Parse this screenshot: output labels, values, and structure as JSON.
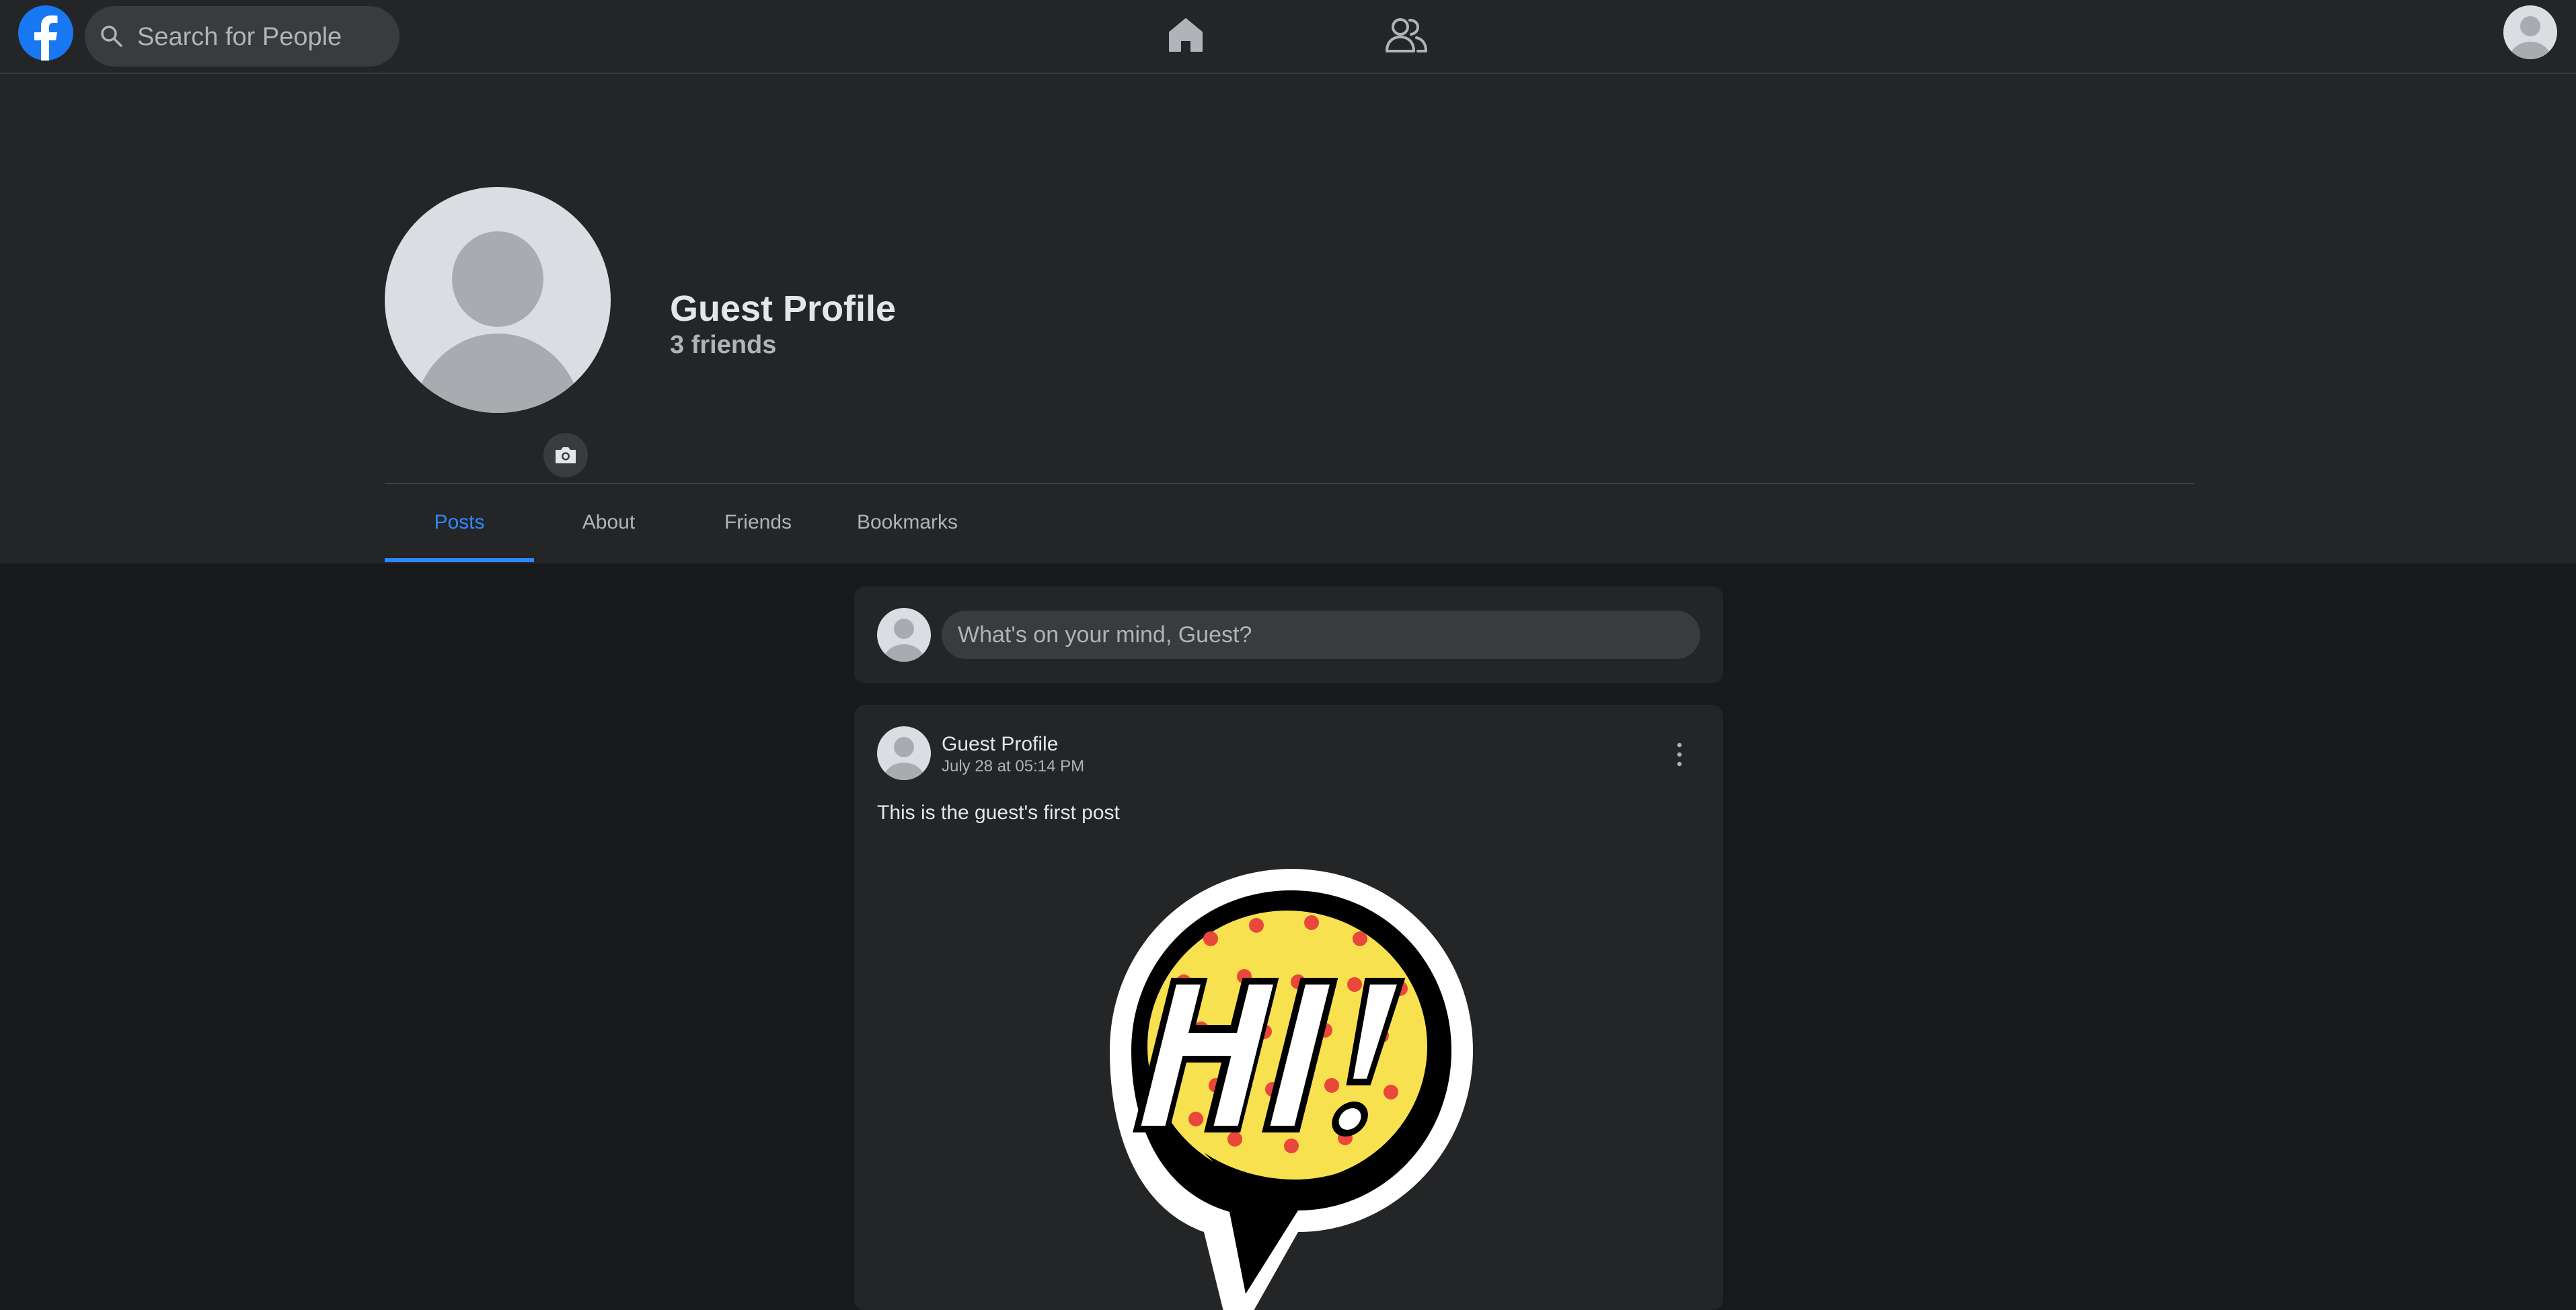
{
  "nav": {
    "search": {
      "placeholder": "Search for People"
    },
    "icons": [
      "facebook-logo",
      "search-icon",
      "home-icon",
      "friends-icon",
      "avatar"
    ]
  },
  "profile": {
    "name": "Guest Profile",
    "friends_count": "3 friends",
    "tabs": [
      {
        "label": "Posts",
        "active": true
      },
      {
        "label": "About",
        "active": false
      },
      {
        "label": "Friends",
        "active": false
      },
      {
        "label": "Bookmarks",
        "active": false
      }
    ]
  },
  "composer": {
    "placeholder": "What's on your mind, Guest?"
  },
  "post": {
    "author": "Guest Profile",
    "timestamp": "July 28 at 05:14 PM",
    "text": "This is the guest's first post",
    "image": "hi-speech-bubble-sticker"
  },
  "colors": {
    "page_bg": "#18191a",
    "surface": "#242526",
    "input": "#3a3b3c",
    "accent": "#2d88ff",
    "text_primary": "#e4e6eb",
    "text_secondary": "#b0b3b8"
  }
}
